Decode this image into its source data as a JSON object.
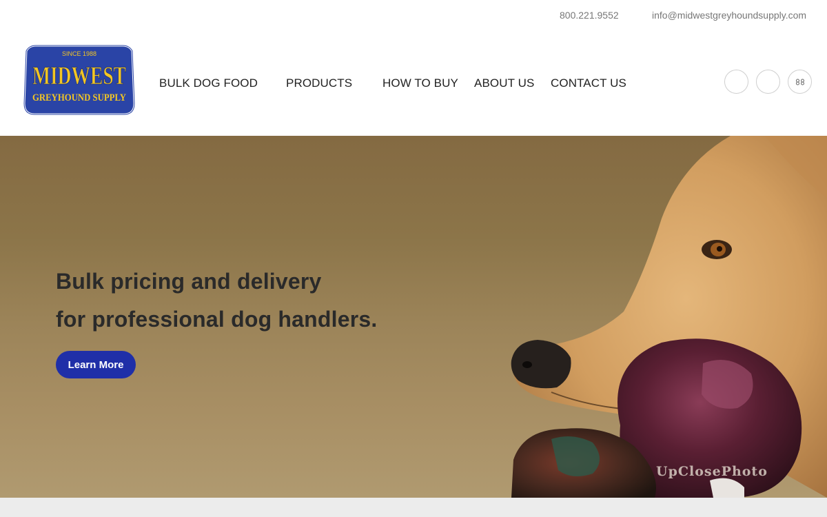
{
  "topbar": {
    "phone": "800.221.9552",
    "email": "info@midwestgreyhoundsupply.com"
  },
  "logo": {
    "since": "SINCE 1988",
    "brand_top": "MIDWEST",
    "brand_bottom": "GREYHOUND SUPPLY",
    "colors": {
      "background": "#2a44a6",
      "text": "#f3c623"
    }
  },
  "nav": {
    "items": [
      {
        "label": "BULK DOG FOOD"
      },
      {
        "label": "PRODUCTS"
      },
      {
        "label": "HOW TO BUY"
      },
      {
        "label": "ABOUT US"
      },
      {
        "label": "CONTACT US"
      }
    ]
  },
  "social": [
    {
      "icon": "facebook-icon"
    },
    {
      "icon": "twitter-icon"
    },
    {
      "icon": "flickr-icon"
    }
  ],
  "hero": {
    "line1": "Bulk pricing and delivery",
    "line2": "for professional dog handlers.",
    "cta_label": "Learn More",
    "watermark": "UpClosePhoto",
    "colors": {
      "cta": "#1f2fa8",
      "heading": "#2a2a2a"
    }
  }
}
